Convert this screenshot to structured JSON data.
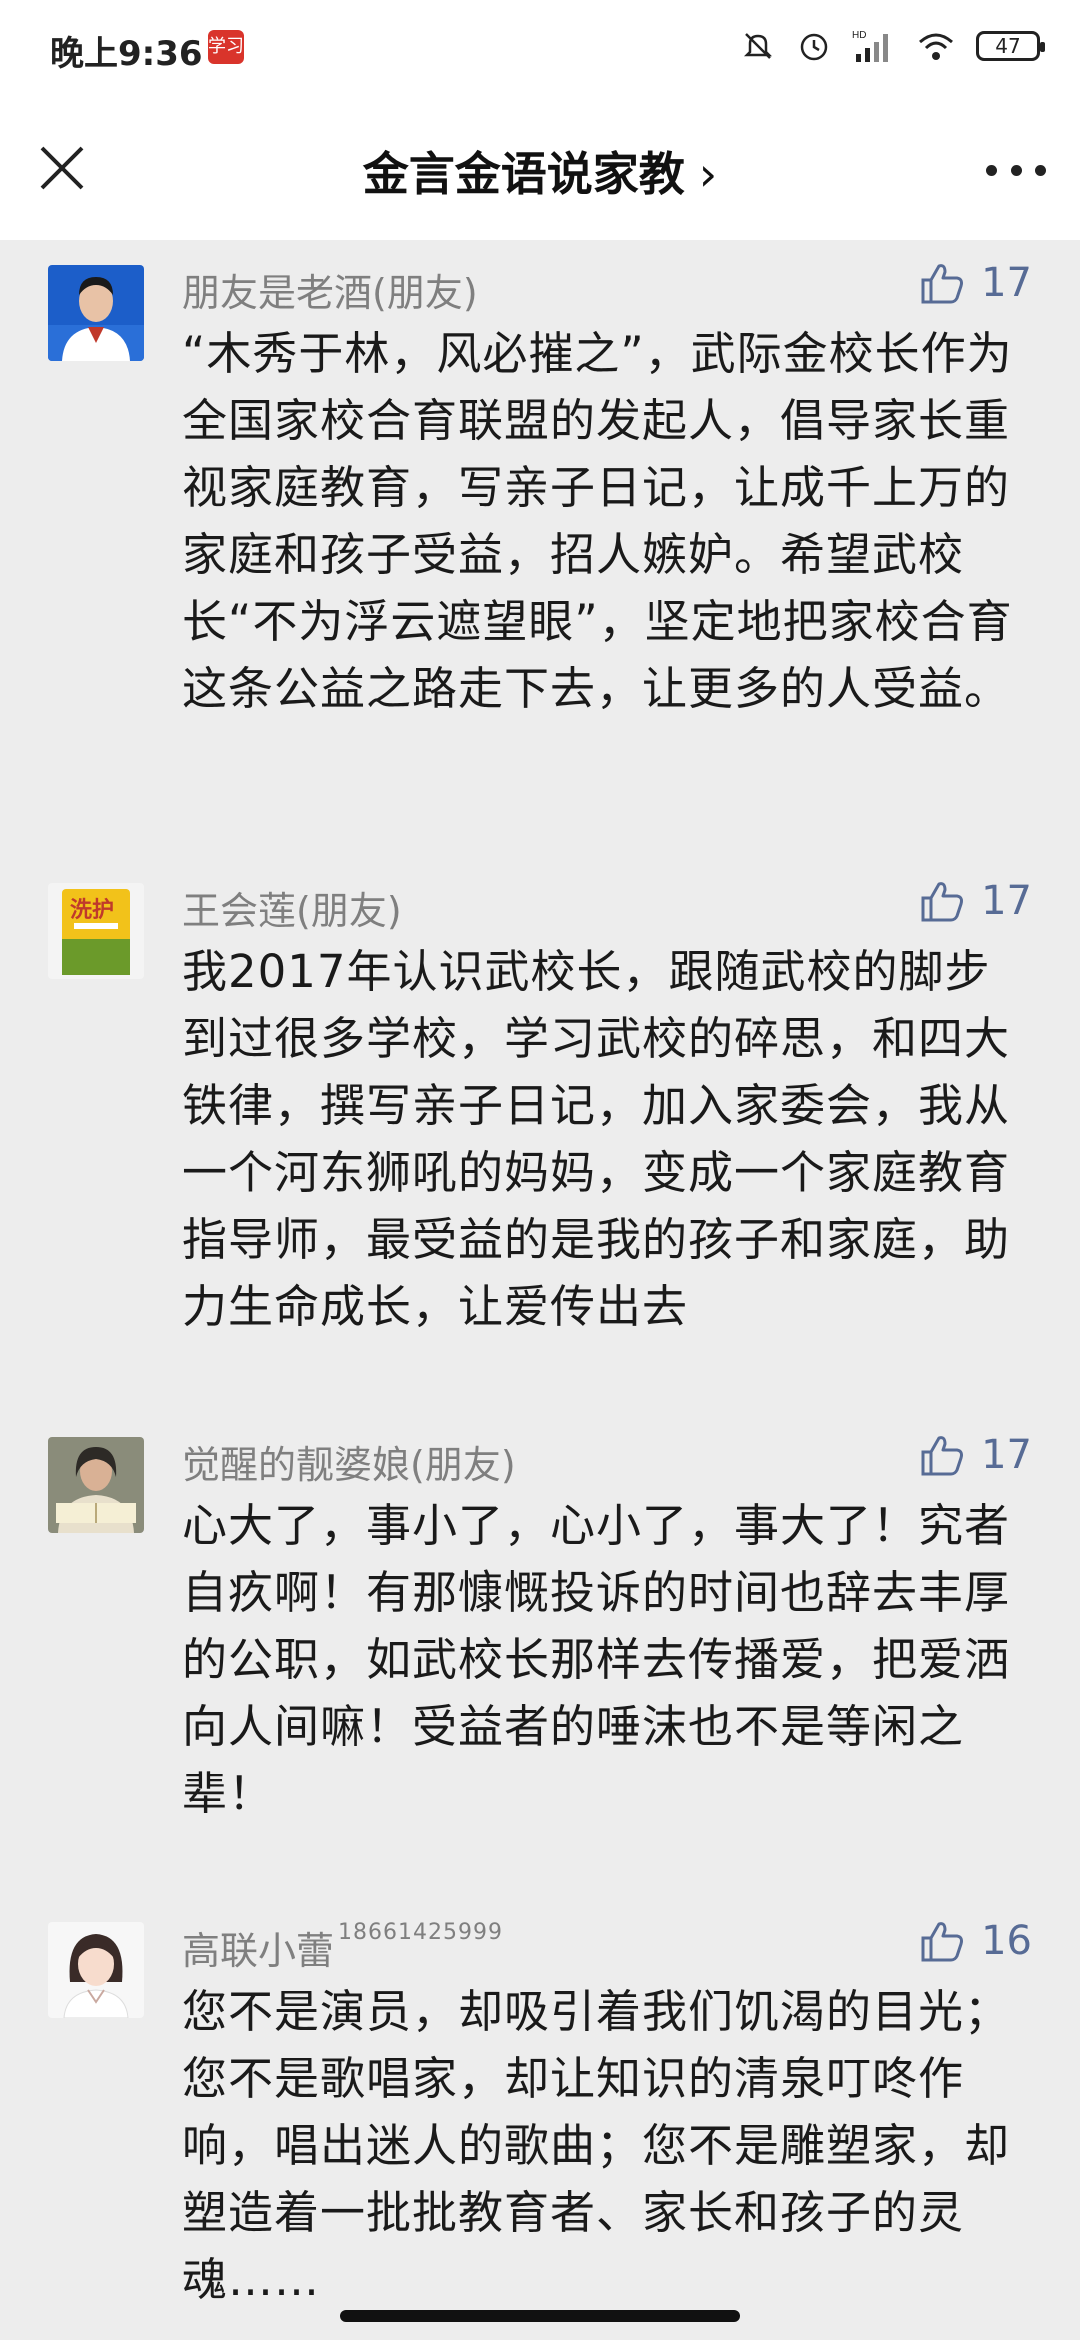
{
  "status_bar": {
    "time": "晚上9:36",
    "app_icon_label": "学习",
    "battery": "47",
    "icons": [
      "mute-icon",
      "alarm-icon",
      "hd-signal-icon",
      "wifi-icon",
      "battery-icon"
    ]
  },
  "nav": {
    "title": "金言金语说家教",
    "chevron": "›",
    "icons": [
      "close-icon",
      "more-icon"
    ]
  },
  "colors": {
    "like": "#576b95",
    "name": "#7f7f7f",
    "background": "#ededed"
  },
  "comments": [
    {
      "name": "朋友是老酒(朋友)",
      "likes": "17",
      "text": "“木秀于林，风必摧之”，武际金校长作为全国家校合育联盟的发起人，倡导家长重视家庭教育，写亲子日记，让成千上万的家庭和孩子受益，招人嫉妒。希望武校长“不为浮云遮望眼”，坚定地把家校合育这条公益之路走下去，让更多的人受益。"
    },
    {
      "name": "王会莲(朋友)",
      "likes": "17",
      "text": "我2017年认识武校长，跟随武校的脚步到过很多学校，学习武校的碎思，和四大铁律，撰写亲子日记，加入家委会，我从一个河东狮吼的妈妈，变成一个家庭教育指导师，最受益的是我的孩子和家庭，助力生命成长，让爱传出去"
    },
    {
      "name": "觉醒的靓婆娘(朋友)",
      "likes": "17",
      "text": "心大了，事小了，心小了，事大了！究者自疚啊！有那慷慨投诉的时间也辞去丰厚的公职，如武校长那样去传播爱，把爱洒向人间嘛！受益者的唾沫也不是等闲之辈！"
    },
    {
      "name": "高联小蕾",
      "name_suffix": "18661425999",
      "likes": "16",
      "text": "您不是演员，却吸引着我们饥渴的目光；您不是歌唱家，却让知识的清泉叮咚作响，唱出迷人的歌曲；您不是雕塑家，却塑造着一批批教育者、家长和孩子的灵魂……"
    }
  ]
}
